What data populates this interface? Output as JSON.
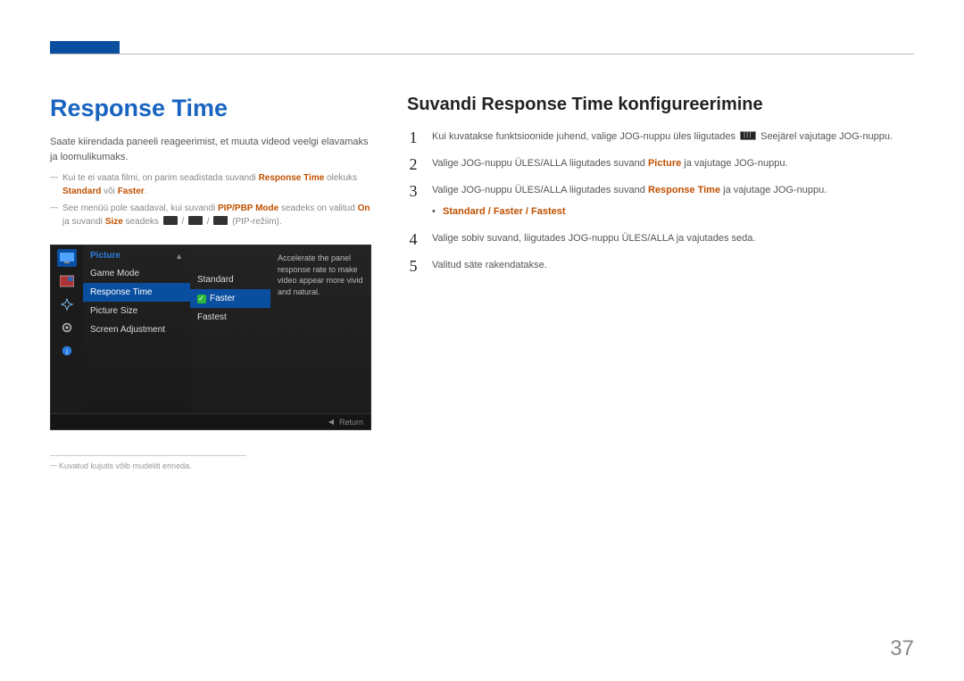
{
  "pageNumber": "37",
  "left": {
    "heading": "Response Time",
    "intro": "Saate kiirendada paneeli reageerimist, et muuta videod veelgi elavamaks ja loomulikumaks.",
    "note1_pre": "Kui te ei vaata filmi, on parim seadistada suvandi ",
    "note1_accent1": "Response Time",
    "note1_mid": " olekuks ",
    "note1_accent2": "Standard",
    "note1_or": " või ",
    "note1_accent3": "Faster",
    "note1_end": ".",
    "note2_pre": "See menüü pole saadaval, kui suvandi ",
    "note2_accent1": "PIP/PBP Mode",
    "note2_mid1": " seadeks on valitud ",
    "note2_accent2": "On",
    "note2_mid2": " ja suvandi ",
    "note2_accent3": "Size",
    "note2_mid3": " seadeks ",
    "note2_end": " (PIP-režiim).",
    "footnote": "Kuvatud kujutis võib mudeliti erineda."
  },
  "osd": {
    "title": "Picture",
    "items": [
      "Game Mode",
      "Response Time",
      "Picture Size",
      "Screen Adjustment"
    ],
    "selectedItemIndex": 1,
    "options": [
      "Standard",
      "Faster",
      "Fastest"
    ],
    "selectedOptionIndex": 1,
    "description": "Accelerate the panel response rate to make video appear more vivid and natural.",
    "returnLabel": "Return"
  },
  "right": {
    "heading": "Suvandi Response Time konfigureerimine",
    "step1_pre": "Kui kuvatakse funktsioonide juhend, valige JOG-nuppu üles liigutades ",
    "step1_post": " Seejärel vajutage JOG-nuppu.",
    "step2_pre": "Valige JOG-nuppu ÜLES/ALLA liigutades suvand ",
    "step2_accent": "Picture",
    "step2_post": " ja vajutage JOG-nuppu.",
    "step3_pre": "Valige JOG-nuppu ÜLES/ALLA liigutades suvand ",
    "step3_accent": "Response Time",
    "step3_post": " ja vajutage JOG-nuppu.",
    "options_line": "Standard / Faster / Fastest",
    "step4": "Valige sobiv suvand, liigutades JOG-nuppu ÜLES/ALLA ja vajutades seda.",
    "step5": "Valitud säte rakendatakse."
  }
}
